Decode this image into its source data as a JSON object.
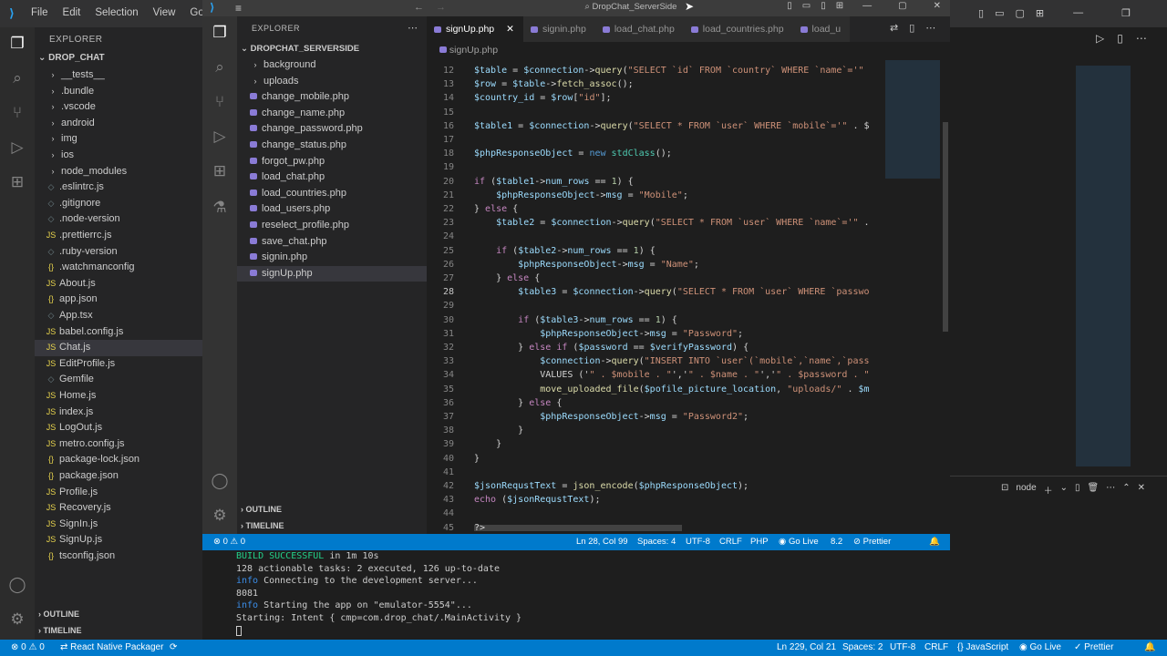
{
  "back": {
    "menu": [
      "File",
      "Edit",
      "Selection",
      "View",
      "Go",
      "Ru"
    ],
    "explorer_title": "EXPLORER",
    "root": "DROP_CHAT",
    "files": [
      {
        "label": "__tests__",
        "kind": "folder"
      },
      {
        "label": ".bundle",
        "kind": "folder"
      },
      {
        "label": ".vscode",
        "kind": "folder"
      },
      {
        "label": "android",
        "kind": "folder"
      },
      {
        "label": "img",
        "kind": "folder"
      },
      {
        "label": "ios",
        "kind": "folder"
      },
      {
        "label": "node_modules",
        "kind": "folder"
      },
      {
        "label": ".eslintrc.js",
        "kind": "file"
      },
      {
        "label": ".gitignore",
        "kind": "file"
      },
      {
        "label": ".node-version",
        "kind": "file"
      },
      {
        "label": ".prettierrc.js",
        "kind": "js"
      },
      {
        "label": ".ruby-version",
        "kind": "file"
      },
      {
        "label": ".watchmanconfig",
        "kind": "json"
      },
      {
        "label": "About.js",
        "kind": "js"
      },
      {
        "label": "app.json",
        "kind": "json"
      },
      {
        "label": "App.tsx",
        "kind": "file"
      },
      {
        "label": "babel.config.js",
        "kind": "js"
      },
      {
        "label": "Chat.js",
        "kind": "js"
      },
      {
        "label": "EditProfile.js",
        "kind": "js"
      },
      {
        "label": "Gemfile",
        "kind": "file"
      },
      {
        "label": "Home.js",
        "kind": "js"
      },
      {
        "label": "index.js",
        "kind": "js"
      },
      {
        "label": "LogOut.js",
        "kind": "js"
      },
      {
        "label": "metro.config.js",
        "kind": "js"
      },
      {
        "label": "package-lock.json",
        "kind": "json"
      },
      {
        "label": "package.json",
        "kind": "json"
      },
      {
        "label": "Profile.js",
        "kind": "js"
      },
      {
        "label": "Recovery.js",
        "kind": "js"
      },
      {
        "label": "SignIn.js",
        "kind": "js"
      },
      {
        "label": "SignUp.js",
        "kind": "js"
      },
      {
        "label": "tsconfig.json",
        "kind": "json"
      }
    ],
    "outline": "OUTLINE",
    "timeline": "TIMELINE",
    "terminal_label": "node",
    "status": {
      "errors": "0",
      "warnings": "0",
      "packager": "React Native Packager",
      "position": "Ln 229, Col 21",
      "spaces": "Spaces: 2",
      "encoding": "UTF-8",
      "eol": "CRLF",
      "language": "JavaScript",
      "golive": "Go Live",
      "prettier": "Prettier"
    }
  },
  "front": {
    "title": "DropChat_ServerSide",
    "explorer_title": "EXPLORER",
    "root": "DROPCHAT_SERVERSIDE",
    "files": [
      "background",
      "uploads",
      "change_mobile.php",
      "change_name.php",
      "change_password.php",
      "change_status.php",
      "forgot_pw.php",
      "load_chat.php",
      "load_countries.php",
      "load_users.php",
      "reselect_profile.php",
      "save_chat.php",
      "signin.php",
      "signUp.php"
    ],
    "outline": "OUTLINE",
    "timeline": "TIMELINE",
    "tabs": [
      "signUp.php",
      "signin.php",
      "load_chat.php",
      "load_countries.php",
      "load_u"
    ],
    "breadcrumb": "signUp.php",
    "code_lines": [
      {
        "n": "12",
        "t": "$table = $connection->query(\"SELECT `id` FROM `country` WHERE `name`='\""
      },
      {
        "n": "13",
        "t": "$row = $table->fetch_assoc();"
      },
      {
        "n": "14",
        "t": "$country_id = $row[\"id\"];"
      },
      {
        "n": "15",
        "t": ""
      },
      {
        "n": "16",
        "t": "$table1 = $connection->query(\"SELECT * FROM `user` WHERE `mobile`='\" . $"
      },
      {
        "n": "17",
        "t": ""
      },
      {
        "n": "18",
        "t": "$phpResponseObject = new stdClass();"
      },
      {
        "n": "19",
        "t": ""
      },
      {
        "n": "20",
        "t": "if ($table1->num_rows == 1) {"
      },
      {
        "n": "21",
        "t": "    $phpResponseObject->msg = \"Mobile\";"
      },
      {
        "n": "22",
        "t": "} else {"
      },
      {
        "n": "23",
        "t": "    $table2 = $connection->query(\"SELECT * FROM `user` WHERE `name`='\" ."
      },
      {
        "n": "24",
        "t": ""
      },
      {
        "n": "25",
        "t": "    if ($table2->num_rows == 1) {"
      },
      {
        "n": "26",
        "t": "        $phpResponseObject->msg = \"Name\";"
      },
      {
        "n": "27",
        "t": "    } else {"
      },
      {
        "n": "28",
        "t": "        $table3 = $connection->query(\"SELECT * FROM `user` WHERE `passwo"
      },
      {
        "n": "29",
        "t": ""
      },
      {
        "n": "30",
        "t": "        if ($table3->num_rows == 1) {"
      },
      {
        "n": "31",
        "t": "            $phpResponseObject->msg = \"Password\";"
      },
      {
        "n": "32",
        "t": "        } else if ($password == $verifyPassword) {"
      },
      {
        "n": "33",
        "t": "            $connection->query(\"INSERT INTO `user`(`mobile`,`name`,`pass"
      },
      {
        "n": "34",
        "t": "            VALUES ('\" . $mobile . \"','\" . $name . \"','\" . $password . \""
      },
      {
        "n": "35",
        "t": "            move_uploaded_file($pofile_picture_location, \"uploads/\" . $m"
      },
      {
        "n": "36",
        "t": "        } else {"
      },
      {
        "n": "37",
        "t": "            $phpResponseObject->msg = \"Password2\";"
      },
      {
        "n": "38",
        "t": "        }"
      },
      {
        "n": "39",
        "t": "    }"
      },
      {
        "n": "40",
        "t": "}"
      },
      {
        "n": "41",
        "t": ""
      },
      {
        "n": "42",
        "t": "$jsonRequstText = json_encode($phpResponseObject);"
      },
      {
        "n": "43",
        "t": "echo ($jsonRequstText);"
      },
      {
        "n": "44",
        "t": ""
      },
      {
        "n": "45",
        "t": "?>"
      }
    ],
    "current_line": "28",
    "status": {
      "errors": "0",
      "warnings": "0",
      "position": "Ln 28, Col 99",
      "spaces": "Spaces: 4",
      "encoding": "UTF-8",
      "eol": "CRLF",
      "language": "PHP",
      "golive": "Go Live",
      "version": "8.2",
      "prettier": "Prettier"
    }
  },
  "terminal_lines": [
    {
      "parts": [
        {
          "text": "BUILD SUCCESSFUL",
          "color": "#23d18b"
        },
        {
          "text": " in 1m 10s",
          "color": "#ccc"
        }
      ]
    },
    {
      "parts": [
        {
          "text": "128 actionable tasks: 2 executed, 126 up-to-date",
          "color": "#ccc"
        }
      ]
    },
    {
      "parts": [
        {
          "text": "info",
          "color": "#3b8eea"
        },
        {
          "text": " Connecting to the development server...",
          "color": "#ccc"
        }
      ]
    },
    {
      "parts": [
        {
          "text": "8081",
          "color": "#ccc"
        }
      ]
    },
    {
      "parts": [
        {
          "text": "info",
          "color": "#3b8eea"
        },
        {
          "text": " Starting the app on \"emulator-5554\"...",
          "color": "#ccc"
        }
      ]
    },
    {
      "parts": [
        {
          "text": "Starting: Intent { cmp=com.drop_chat/.MainActivity }",
          "color": "#ccc"
        }
      ]
    }
  ]
}
